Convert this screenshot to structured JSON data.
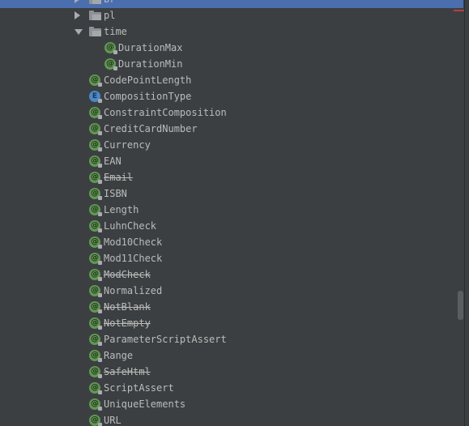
{
  "tree": {
    "folders": [
      {
        "label": "br",
        "state": "collapsed"
      },
      {
        "label": "pl",
        "state": "collapsed"
      },
      {
        "label": "time",
        "state": "expanded"
      }
    ],
    "time_children": [
      {
        "label": "DurationMax",
        "icon": "annotation-icon",
        "icon_glyph": "@"
      },
      {
        "label": "DurationMin",
        "icon": "annotation-icon",
        "icon_glyph": "@"
      }
    ],
    "items": [
      {
        "label": "CodePointLength",
        "icon": "annotation-icon",
        "icon_glyph": "@",
        "deprecated": false
      },
      {
        "label": "CompositionType",
        "icon": "enum-icon",
        "icon_glyph": "E",
        "deprecated": false
      },
      {
        "label": "ConstraintComposition",
        "icon": "annotation-icon",
        "icon_glyph": "@",
        "deprecated": false
      },
      {
        "label": "CreditCardNumber",
        "icon": "annotation-icon",
        "icon_glyph": "@",
        "deprecated": false
      },
      {
        "label": "Currency",
        "icon": "annotation-icon",
        "icon_glyph": "@",
        "deprecated": false
      },
      {
        "label": "EAN",
        "icon": "annotation-icon",
        "icon_glyph": "@",
        "deprecated": false
      },
      {
        "label": "Email",
        "icon": "annotation-icon",
        "icon_glyph": "@",
        "deprecated": true
      },
      {
        "label": "ISBN",
        "icon": "annotation-icon",
        "icon_glyph": "@",
        "deprecated": false
      },
      {
        "label": "Length",
        "icon": "annotation-icon",
        "icon_glyph": "@",
        "deprecated": false
      },
      {
        "label": "LuhnCheck",
        "icon": "annotation-icon",
        "icon_glyph": "@",
        "deprecated": false
      },
      {
        "label": "Mod10Check",
        "icon": "annotation-icon",
        "icon_glyph": "@",
        "deprecated": false
      },
      {
        "label": "Mod11Check",
        "icon": "annotation-icon",
        "icon_glyph": "@",
        "deprecated": false
      },
      {
        "label": "ModCheck",
        "icon": "annotation-icon",
        "icon_glyph": "@",
        "deprecated": true
      },
      {
        "label": "Normalized",
        "icon": "annotation-icon",
        "icon_glyph": "@",
        "deprecated": false
      },
      {
        "label": "NotBlank",
        "icon": "annotation-icon",
        "icon_glyph": "@",
        "deprecated": true
      },
      {
        "label": "NotEmpty",
        "icon": "annotation-icon",
        "icon_glyph": "@",
        "deprecated": true
      },
      {
        "label": "ParameterScriptAssert",
        "icon": "annotation-icon",
        "icon_glyph": "@",
        "deprecated": false
      },
      {
        "label": "Range",
        "icon": "annotation-icon",
        "icon_glyph": "@",
        "deprecated": false
      },
      {
        "label": "SafeHtml",
        "icon": "annotation-icon",
        "icon_glyph": "@",
        "deprecated": true
      },
      {
        "label": "ScriptAssert",
        "icon": "annotation-icon",
        "icon_glyph": "@",
        "deprecated": false
      },
      {
        "label": "UniqueElements",
        "icon": "annotation-icon",
        "icon_glyph": "@",
        "deprecated": false
      },
      {
        "label": "URL",
        "icon": "annotation-icon",
        "icon_glyph": "@",
        "deprecated": false
      }
    ]
  },
  "colors": {
    "background": "#3c3f41",
    "selection": "#4b6eaf",
    "text": "#bbbbbb",
    "annotation_icon": "#629755",
    "enum_icon": "#4a88c7",
    "folder_icon": "#8e9296",
    "error_stripe": "#bc3f3c"
  }
}
